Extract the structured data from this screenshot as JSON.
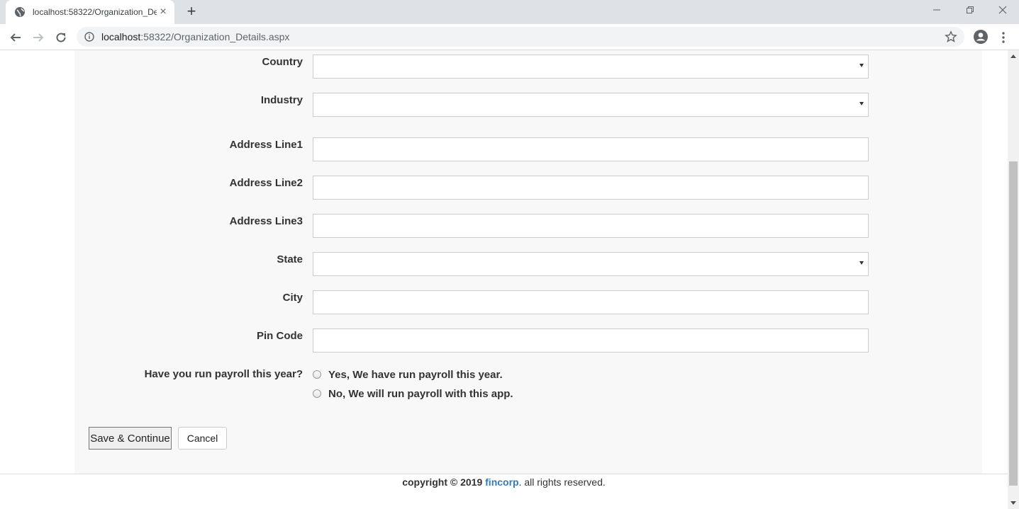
{
  "browser": {
    "tab_title": "localhost:58322/Organization_De",
    "url_host": "localhost",
    "url_path": ":58322/Organization_Details.aspx",
    "window_controls": [
      "minimize-icon",
      "restore-icon",
      "close-icon"
    ]
  },
  "form": {
    "fields": [
      {
        "label": "Country",
        "type": "select",
        "value": ""
      },
      {
        "label": "Industry",
        "type": "select",
        "value": ""
      },
      {
        "label": "Address Line1",
        "type": "text",
        "value": ""
      },
      {
        "label": "Address Line2",
        "type": "text",
        "value": ""
      },
      {
        "label": "Address Line3",
        "type": "text",
        "value": ""
      },
      {
        "label": "State",
        "type": "select",
        "value": ""
      },
      {
        "label": "City",
        "type": "text",
        "value": ""
      },
      {
        "label": "Pin Code",
        "type": "text",
        "value": ""
      }
    ],
    "payroll_question": "Have you run payroll this year?",
    "payroll_options": [
      {
        "label": "Yes, We have run payroll this year.",
        "checked": false
      },
      {
        "label": "No, We will run payroll with this app.",
        "checked": false
      }
    ],
    "save_label": "Save & Continue",
    "cancel_label": "Cancel"
  },
  "footer": {
    "copyright": "copyright © 2019",
    "brand": "fincorp",
    "suffix": ". all rights reserved."
  },
  "colors": {
    "brand": "#337ab7",
    "panel_bg": "#f8f8f8"
  }
}
